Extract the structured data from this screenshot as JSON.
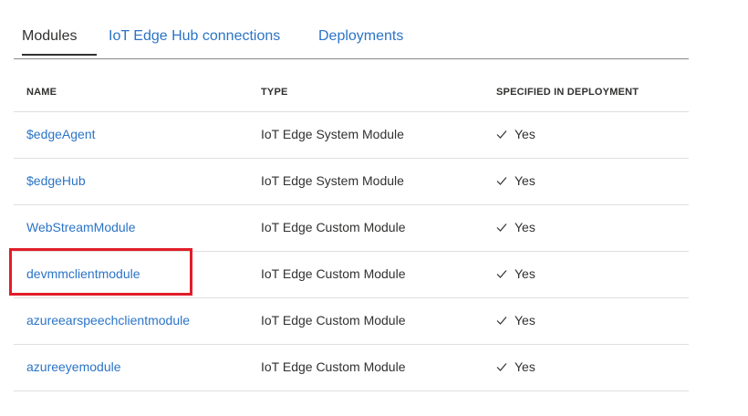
{
  "tabs": [
    {
      "label": "Modules",
      "active": true
    },
    {
      "label": "IoT Edge Hub connections",
      "active": false
    },
    {
      "label": "Deployments",
      "active": false
    }
  ],
  "table": {
    "headers": {
      "name": "NAME",
      "type": "TYPE",
      "specified": "SPECIFIED IN DEPLOYMENT"
    },
    "rows": [
      {
        "name": "$edgeAgent",
        "type": "IoT Edge System Module",
        "specified": "Yes"
      },
      {
        "name": "$edgeHub",
        "type": "IoT Edge System Module",
        "specified": "Yes"
      },
      {
        "name": "WebStreamModule",
        "type": "IoT Edge Custom Module",
        "specified": "Yes"
      },
      {
        "name": "devmmclientmodule",
        "type": "IoT Edge Custom Module",
        "specified": "Yes",
        "highlighted": true
      },
      {
        "name": "azureearspeechclientmodule",
        "type": "IoT Edge Custom Module",
        "specified": "Yes"
      },
      {
        "name": "azureeyemodule",
        "type": "IoT Edge Custom Module",
        "specified": "Yes"
      }
    ]
  },
  "colors": {
    "link": "#2b74c7",
    "highlight": "#e11d2a",
    "text": "#323130",
    "divider": "#e1dfdd"
  },
  "icons": {
    "specified": "checkmark-icon"
  }
}
